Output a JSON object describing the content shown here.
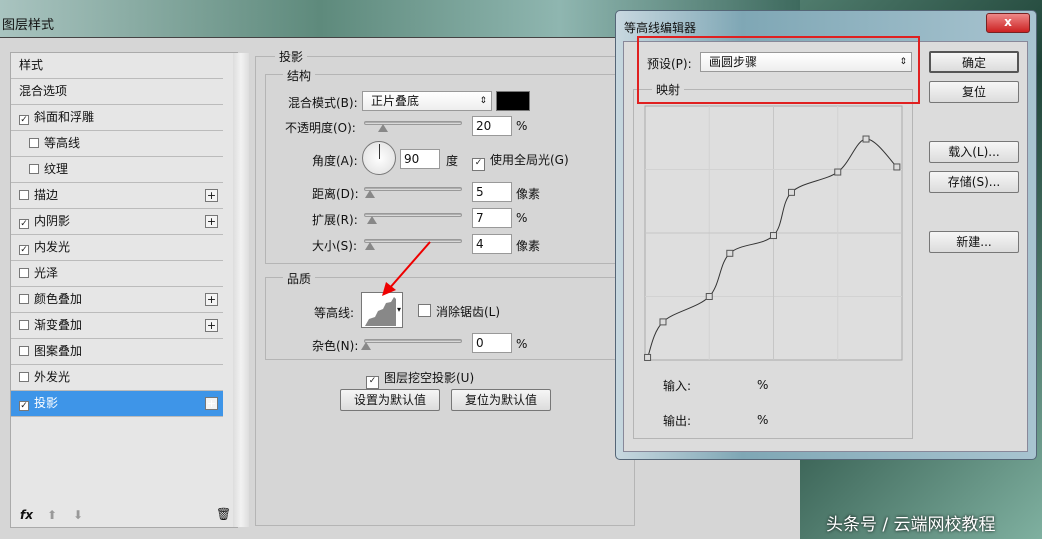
{
  "layer_style": {
    "title": "图层样式",
    "styles": [
      {
        "label": "样式",
        "checkbox": null,
        "plus": false
      },
      {
        "label": "混合选项",
        "checkbox": null,
        "plus": false
      },
      {
        "label": "斜面和浮雕",
        "checkbox": true,
        "plus": false
      },
      {
        "label": "等高线",
        "checkbox": false,
        "plus": false,
        "indent": true
      },
      {
        "label": "纹理",
        "checkbox": false,
        "plus": false,
        "indent": true
      },
      {
        "label": "描边",
        "checkbox": false,
        "plus": true
      },
      {
        "label": "内阴影",
        "checkbox": true,
        "plus": true
      },
      {
        "label": "内发光",
        "checkbox": true,
        "plus": false
      },
      {
        "label": "光泽",
        "checkbox": false,
        "plus": false
      },
      {
        "label": "颜色叠加",
        "checkbox": false,
        "plus": true
      },
      {
        "label": "渐变叠加",
        "checkbox": false,
        "plus": true
      },
      {
        "label": "图案叠加",
        "checkbox": false,
        "plus": false
      },
      {
        "label": "外发光",
        "checkbox": false,
        "plus": false
      },
      {
        "label": "投影",
        "checkbox": true,
        "plus": true,
        "selected": true
      }
    ],
    "footer": {
      "fx": "fx"
    },
    "section": "投影",
    "structure": "结构",
    "blend_mode_label": "混合模式(B):",
    "blend_mode": "正片叠底",
    "shadow_color": "#000000",
    "opacity_label": "不透明度(O):",
    "opacity": "20",
    "opacity_unit": "%",
    "angle_label": "角度(A):",
    "angle": "90",
    "angle_unit": "度",
    "global_light_label": "使用全局光(G)",
    "distance_label": "距离(D):",
    "distance": "5",
    "distance_unit": "像素",
    "spread_label": "扩展(R):",
    "spread": "7",
    "spread_unit": "%",
    "size_label": "大小(S):",
    "size": "4",
    "size_unit": "像素",
    "quality": "品质",
    "contour_label": "等高线:",
    "antialias_label": "消除锯齿(L)",
    "noise_label": "杂色(N):",
    "noise": "0",
    "noise_unit": "%",
    "knockout_label": "图层挖空投影(U)",
    "set_default": "设置为默认值",
    "reset_default": "复位为默认值"
  },
  "contour_editor": {
    "title": "等高线编辑器",
    "close": "x",
    "preset_label": "预设(P):",
    "preset": "画圆步骤",
    "mapping": "映射",
    "ok": "确定",
    "reset": "复位",
    "load": "载入(L)...",
    "save": "存储(S)...",
    "new": "新建...",
    "input_label": "输入:",
    "input_unit": "%",
    "output_label": "输出:",
    "output_unit": "%"
  },
  "chart_data": {
    "type": "line",
    "title": "映射",
    "xlim": [
      0,
      100
    ],
    "ylim": [
      0,
      100
    ],
    "x": [
      1,
      7,
      25,
      33,
      50,
      57,
      75,
      86,
      98
    ],
    "y": [
      1,
      15,
      25,
      42,
      49,
      66,
      74,
      87,
      76
    ]
  },
  "watermark": "头条号 / 云端网校教程"
}
